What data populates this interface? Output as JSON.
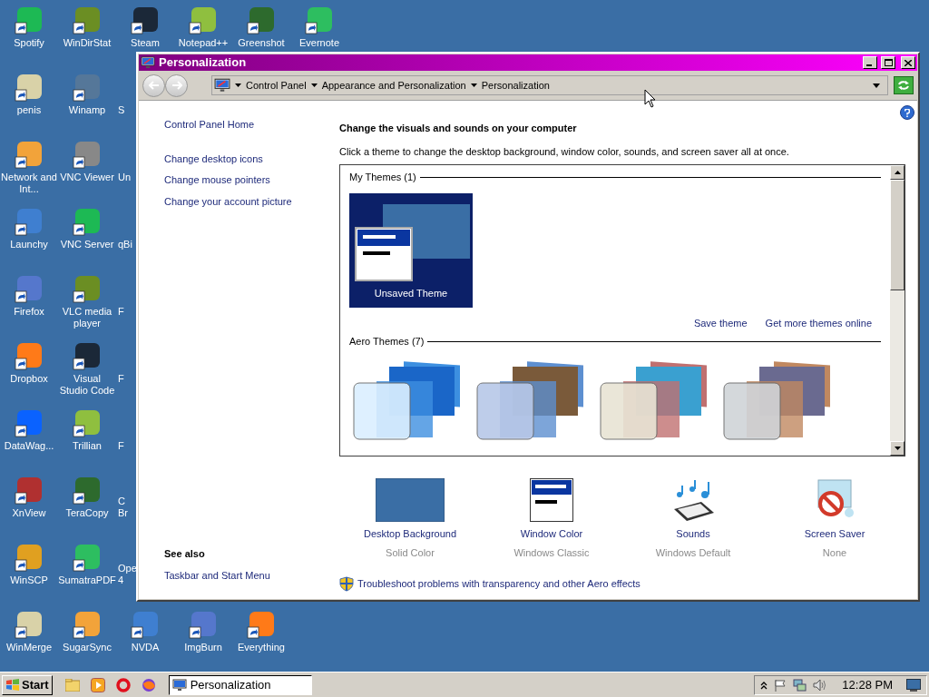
{
  "desktop": {
    "top_row": [
      "Spotify",
      "WinDirStat",
      "Steam",
      "Notepad++",
      "Greenshot",
      "Evernote"
    ],
    "left_columns": [
      [
        "penis",
        "Network and Int...",
        "Launchy",
        "Firefox",
        "Dropbox",
        "DataWag...",
        "XnView",
        "WinSCP"
      ],
      [
        "Winamp",
        "VNC Viewer",
        "VNC Server",
        "VLC media player",
        "Visual Studio Code",
        "Trillian",
        "TeraCopy",
        "SumatraPDF"
      ]
    ],
    "partial_column": [
      [
        "S"
      ],
      [
        "Un"
      ],
      [
        "qBi"
      ],
      [
        "F"
      ],
      [
        "F"
      ],
      [
        "F"
      ],
      [
        "C",
        "Br"
      ],
      [
        "Ope",
        "4"
      ]
    ],
    "bottom_row": [
      "WinMerge",
      "SugarSync",
      "NVDA",
      "ImgBurn",
      "Everything"
    ]
  },
  "window": {
    "title": "Personalization",
    "breadcrumb": [
      "Control Panel",
      "Appearance and Personalization",
      "Personalization"
    ],
    "left_pane": {
      "home": "Control Panel Home",
      "links": [
        "Change desktop icons",
        "Change mouse pointers",
        "Change your account picture"
      ],
      "see_also_title": "See also",
      "see_also_links": [
        "Taskbar and Start Menu"
      ]
    },
    "heading": "Change the visuals and sounds on your computer",
    "description": "Click a theme to change the desktop background, window color, sounds, and screen saver all at once.",
    "theme_groups": [
      {
        "title": "My Themes (1)",
        "themes": [
          {
            "kind": "custom",
            "name": "Unsaved Theme",
            "selected": true
          }
        ],
        "links": [
          "Save theme",
          "Get more themes online"
        ]
      },
      {
        "title": "Aero Themes (7)",
        "themes": [
          {
            "kind": "aero",
            "selected": false
          },
          {
            "kind": "aero",
            "selected": false
          },
          {
            "kind": "aero",
            "selected": false
          },
          {
            "kind": "aero",
            "selected": false
          }
        ]
      }
    ],
    "settings": [
      {
        "kind": "background",
        "label": "Desktop Background",
        "value": "Solid Color"
      },
      {
        "kind": "window_color",
        "label": "Window Color",
        "value": "Windows Classic"
      },
      {
        "kind": "sounds",
        "label": "Sounds",
        "value": "Windows Default"
      },
      {
        "kind": "screen_saver",
        "label": "Screen Saver",
        "value": "None"
      }
    ],
    "troubleshoot_link": "Troubleshoot problems with transparency and other Aero effects"
  },
  "taskbar": {
    "start": "Start",
    "tasks": [
      {
        "label": "Personalization",
        "selected": true
      }
    ],
    "clock": "12:28 PM"
  }
}
